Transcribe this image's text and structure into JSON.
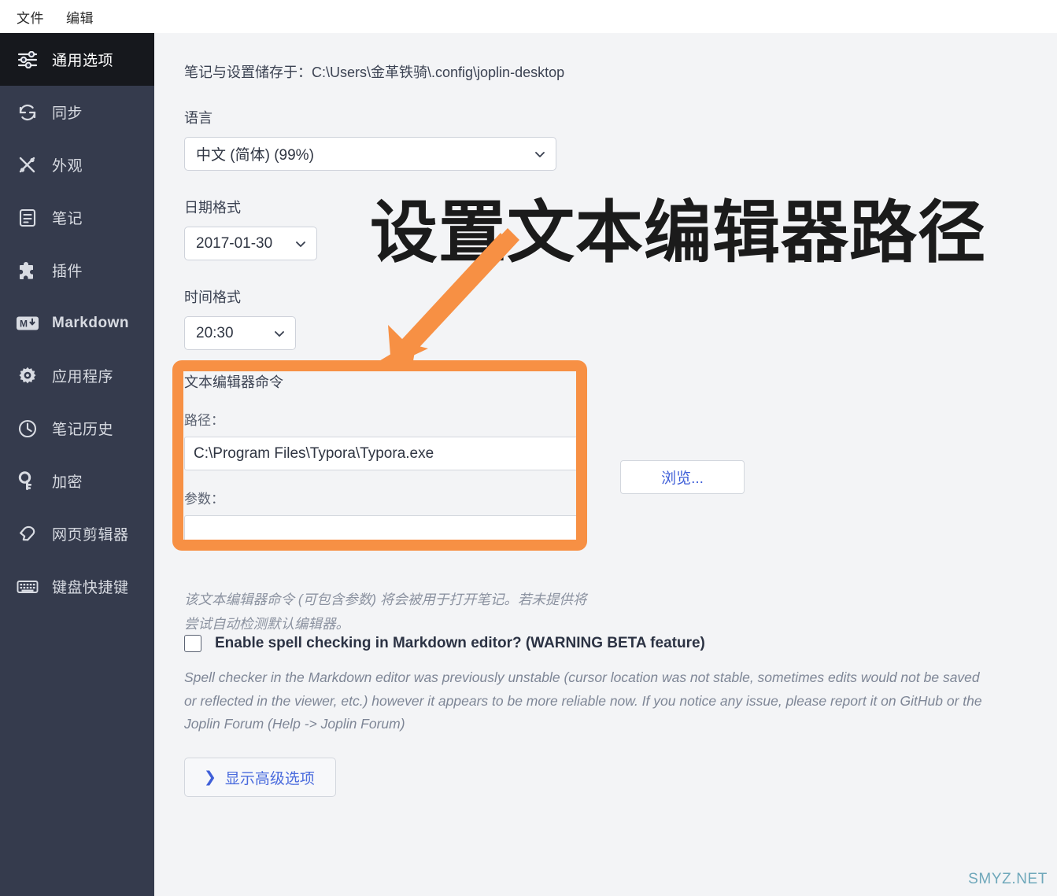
{
  "menubar": {
    "items": [
      {
        "label": "文件",
        "name": "menu-file"
      },
      {
        "label": "编辑",
        "name": "menu-edit"
      }
    ]
  },
  "sidebar": {
    "items": [
      {
        "label": "通用选项",
        "icon": "sliders-icon",
        "active": true
      },
      {
        "label": "同步",
        "icon": "sync-icon",
        "active": false
      },
      {
        "label": "外观",
        "icon": "appearance-icon",
        "active": false
      },
      {
        "label": "笔记",
        "icon": "note-icon",
        "active": false
      },
      {
        "label": "插件",
        "icon": "plugin-icon",
        "active": false
      },
      {
        "label": "Markdown",
        "icon": "markdown-icon",
        "active": false
      },
      {
        "label": "应用程序",
        "icon": "gear-icon",
        "active": false
      },
      {
        "label": "笔记历史",
        "icon": "clock-icon",
        "active": false
      },
      {
        "label": "加密",
        "icon": "key-icon",
        "active": false
      },
      {
        "label": "网页剪辑器",
        "icon": "web-clipper-icon",
        "active": false
      },
      {
        "label": "键盘快捷键",
        "icon": "keyboard-icon",
        "active": false
      }
    ]
  },
  "main": {
    "storage_line": "笔记与设置储存于：C:\\Users\\金革铁骑\\.config\\joplin-desktop",
    "language": {
      "label": "语言",
      "value": "中文 (简体) (99%)"
    },
    "date_format": {
      "label": "日期格式",
      "value": "2017-01-30"
    },
    "time_format": {
      "label": "时间格式",
      "value": "20:30"
    },
    "editor_command": {
      "title": "文本编辑器命令",
      "path_label": "路径：",
      "path_value": "C:\\Program Files\\Typora\\Typora.exe",
      "args_label": "参数：",
      "args_value": "",
      "browse_label": "浏览...",
      "description": "该文本编辑器命令 (可包含参数) 将会被用于打开笔记。若未提供将尝试自动检测默认编辑器。"
    },
    "spellcheck": {
      "label": "Enable spell checking in Markdown editor? (WARNING BETA feature)",
      "checked": false,
      "description": "Spell checker in the Markdown editor was previously unstable (cursor location was not stable, sometimes edits would not be saved or reflected in the viewer, etc.) however it appears to be more reliable now. If you notice any issue, please report it on GitHub or the Joplin Forum (Help -> Joplin Forum)"
    },
    "advanced_button": {
      "arrow": "❯",
      "label": "显示高级选项"
    }
  },
  "annotation": {
    "headline": "设置文本编辑器路径",
    "accent_color": "#f79044"
  },
  "watermark": {
    "text": "SMYZ.NET"
  }
}
